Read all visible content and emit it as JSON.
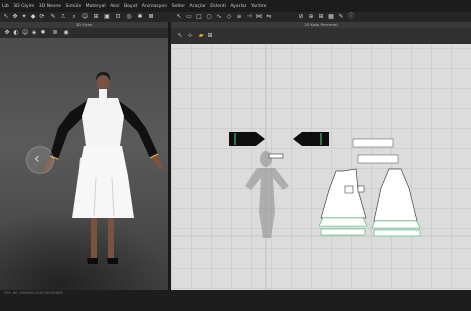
{
  "menu": {
    "items": [
      "Lib",
      "3D Giyim",
      "3D Nesne",
      "Simüle",
      "Materyal",
      "Aksi",
      "Boyut",
      "Animasyon",
      "Setler",
      "Araçlar",
      "Eklenti",
      "Ayarlar",
      "Yardım"
    ]
  },
  "panels": {
    "view3d_title": "3D Giyim",
    "view2d_title": "2D Kalıp Penceresi"
  },
  "status": {
    "text": "FPS: 60  |  MARVELOUS DESIGNER"
  },
  "colors": {
    "dress": "#ffffff",
    "sleeve": "#111111",
    "sleeve_trim": "#e7a23a",
    "pattern_highlight": "#3bbf74"
  }
}
